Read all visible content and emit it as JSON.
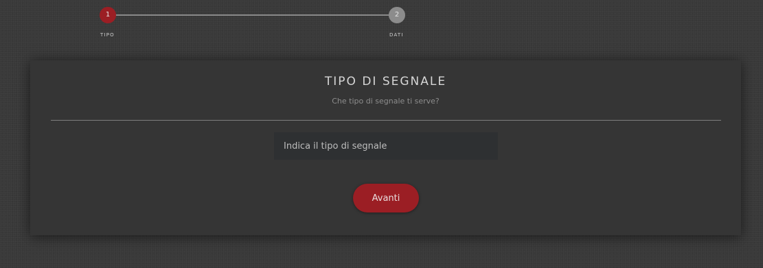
{
  "stepper": {
    "steps": [
      {
        "number": "1",
        "label": "TIPO",
        "state": "active"
      },
      {
        "number": "2",
        "label": "DATI",
        "state": "inactive"
      }
    ]
  },
  "card": {
    "title": "TIPO DI SEGNALE",
    "subtitle": "Che tipo di segnale ti serve?",
    "input": {
      "value": "",
      "placeholder": "Indica il tipo di segnale"
    },
    "next_label": "Avanti"
  },
  "colors": {
    "accent": "#9b1e24",
    "inactive_step": "#8c8c8c",
    "background": "#393939",
    "card": "#353535"
  }
}
